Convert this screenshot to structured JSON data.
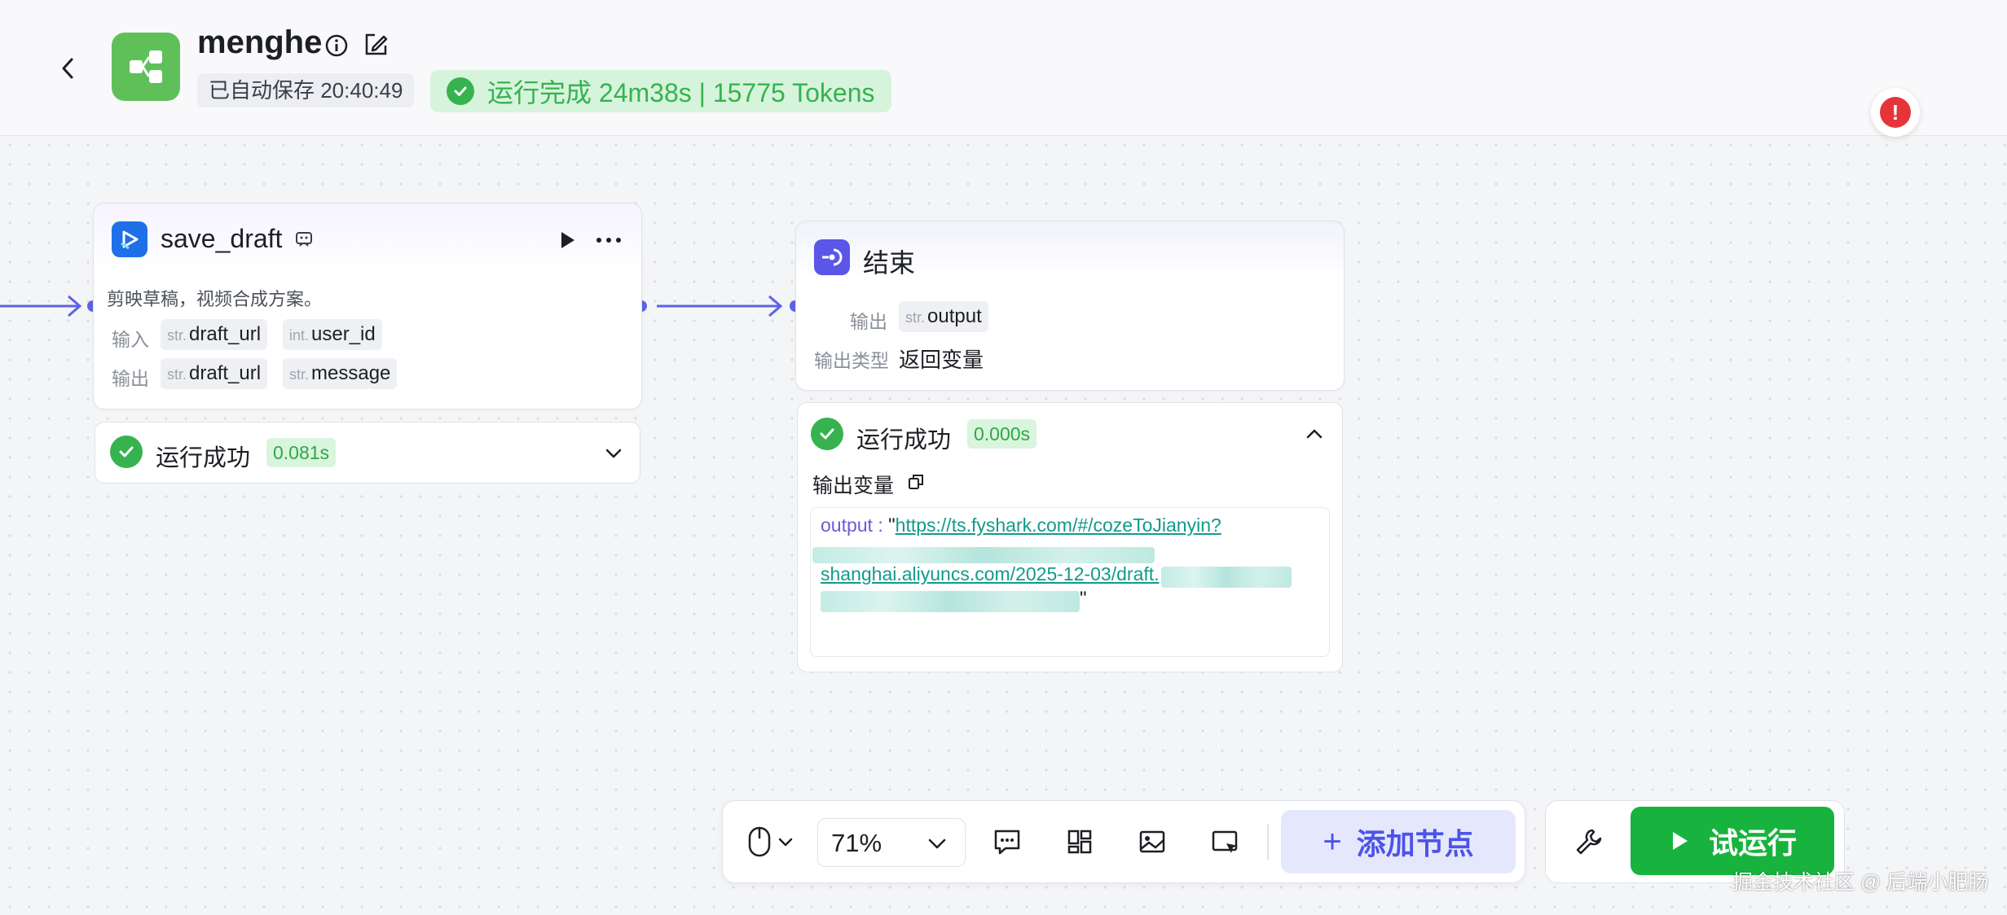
{
  "header": {
    "app_name": "menghe",
    "autosave": "已自动保存 20:40:49",
    "run_status": "运行完成 24m38s | 15775 Tokens"
  },
  "nodes": {
    "save_draft": {
      "title": "save_draft",
      "description": "剪映草稿，视频合成方案。",
      "input_label": "输入",
      "output_label": "输出",
      "inputs": [
        {
          "type": "str.",
          "name": "draft_url"
        },
        {
          "type": "int.",
          "name": "user_id"
        }
      ],
      "outputs": [
        {
          "type": "str.",
          "name": "draft_url"
        },
        {
          "type": "str.",
          "name": "message"
        }
      ],
      "result": {
        "status": "运行成功",
        "time": "0.081s"
      }
    },
    "end": {
      "title": "结束",
      "output_label": "输出",
      "output_type_label": "输出类型",
      "outputs": [
        {
          "type": "str.",
          "name": "output"
        }
      ],
      "output_type_value": "返回变量",
      "result": {
        "status": "运行成功",
        "time": "0.000s",
        "var_title": "输出变量",
        "out_key": "output : ",
        "quote_open": "\"",
        "link_line1": "https://ts.fyshark.com/#/cozeToJianyin?",
        "link_line2": "shanghai.aliyuncs.com/2025-12-03/draft.",
        "quote_close": "\""
      }
    }
  },
  "toolbar": {
    "zoom": "71%",
    "add_node": "添加节点",
    "trial_run": "试运行"
  },
  "watermark": "掘金技术社区 @ 后端小肥肠",
  "colors": {
    "accent": "#4d53e8",
    "success": "#36b24f",
    "run_button": "#18b33e",
    "alert": "#e5353a"
  }
}
